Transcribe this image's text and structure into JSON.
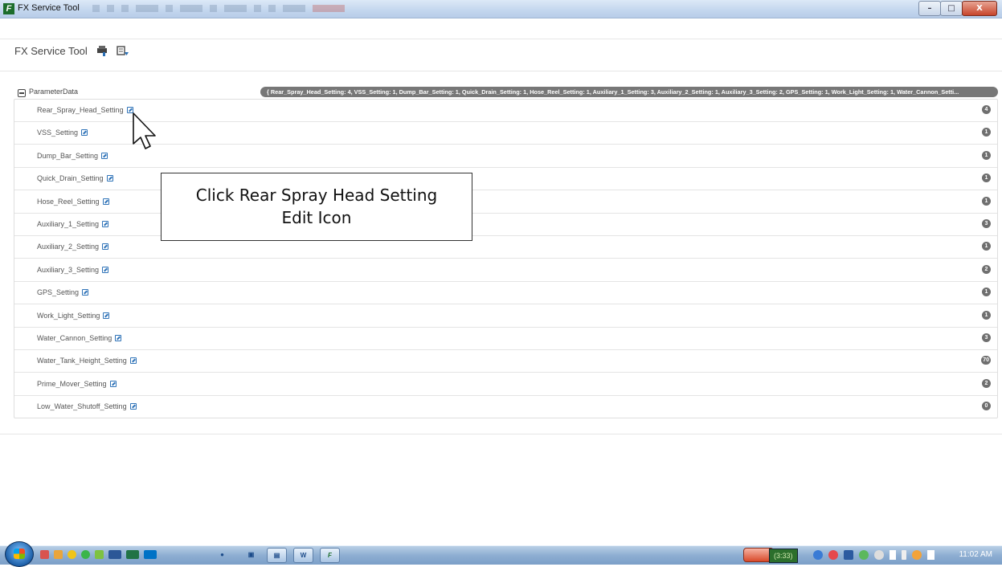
{
  "window": {
    "title": "FX Service Tool",
    "controls": {
      "minimize": "–",
      "maximize": "□",
      "close": "X"
    }
  },
  "app_header": {
    "name": "FX Service Tool",
    "icons": [
      "print-icon",
      "refresh-icon"
    ]
  },
  "parameter_data": {
    "label": "ParameterData",
    "summary": "{ Rear_Spray_Head_Setting: 4, VSS_Setting: 1, Dump_Bar_Setting: 1, Quick_Drain_Setting: 1, Hose_Reel_Setting: 1, Auxiliary_1_Setting: 3, Auxiliary_2_Setting: 1, Auxiliary_3_Setting: 2, GPS_Setting: 1, Work_Light_Setting: 1, Water_Cannon_Setti...",
    "items": [
      {
        "name": "Rear_Spray_Head_Setting",
        "count": "4"
      },
      {
        "name": "VSS_Setting",
        "count": "1"
      },
      {
        "name": "Dump_Bar_Setting",
        "count": "1"
      },
      {
        "name": "Quick_Drain_Setting",
        "count": "1"
      },
      {
        "name": "Hose_Reel_Setting",
        "count": "1"
      },
      {
        "name": "Auxiliary_1_Setting",
        "count": "3"
      },
      {
        "name": "Auxiliary_2_Setting",
        "count": "1"
      },
      {
        "name": "Auxiliary_3_Setting",
        "count": "2"
      },
      {
        "name": "GPS_Setting",
        "count": "1"
      },
      {
        "name": "Work_Light_Setting",
        "count": "1"
      },
      {
        "name": "Water_Cannon_Setting",
        "count": "3"
      },
      {
        "name": "Water_Tank_Height_Setting",
        "count": "70"
      },
      {
        "name": "Prime_Mover_Setting",
        "count": "2"
      },
      {
        "name": "Low_Water_Shutoff_Setting",
        "count": "0"
      }
    ]
  },
  "annotation": {
    "line1": "Click Rear Spray Head Setting",
    "line2": "Edit Icon"
  },
  "taskbar": {
    "timer": "(3:33)",
    "clock": "11:02 AM"
  }
}
